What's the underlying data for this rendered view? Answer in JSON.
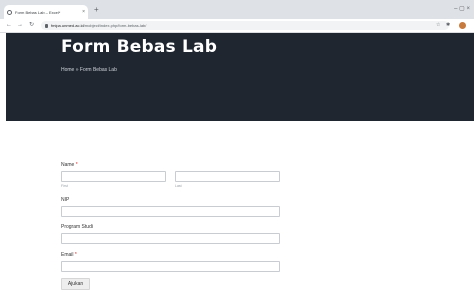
{
  "browser": {
    "tab_title": "Form Bebas Lab – Excel*",
    "tab_close": "×",
    "new_tab": "+",
    "window_controls": "– ▢ ×",
    "url_domain": "fmipa.unmed.ac.id",
    "url_path": "/mobject/index.php/form-bebas-lab/",
    "nav_back": "←",
    "nav_forward": "→",
    "nav_reload": "↻"
  },
  "hero": {
    "title": "Form Bebas Lab",
    "breadcrumb": "Home » Form Bebas Lab"
  },
  "form": {
    "name_label": "Name",
    "required_mark": "*",
    "first_caption": "First",
    "last_caption": "Last",
    "nip_label": "NIP",
    "program_label": "Program Studi",
    "email_label": "Email",
    "submit_label": "Ajukan"
  }
}
